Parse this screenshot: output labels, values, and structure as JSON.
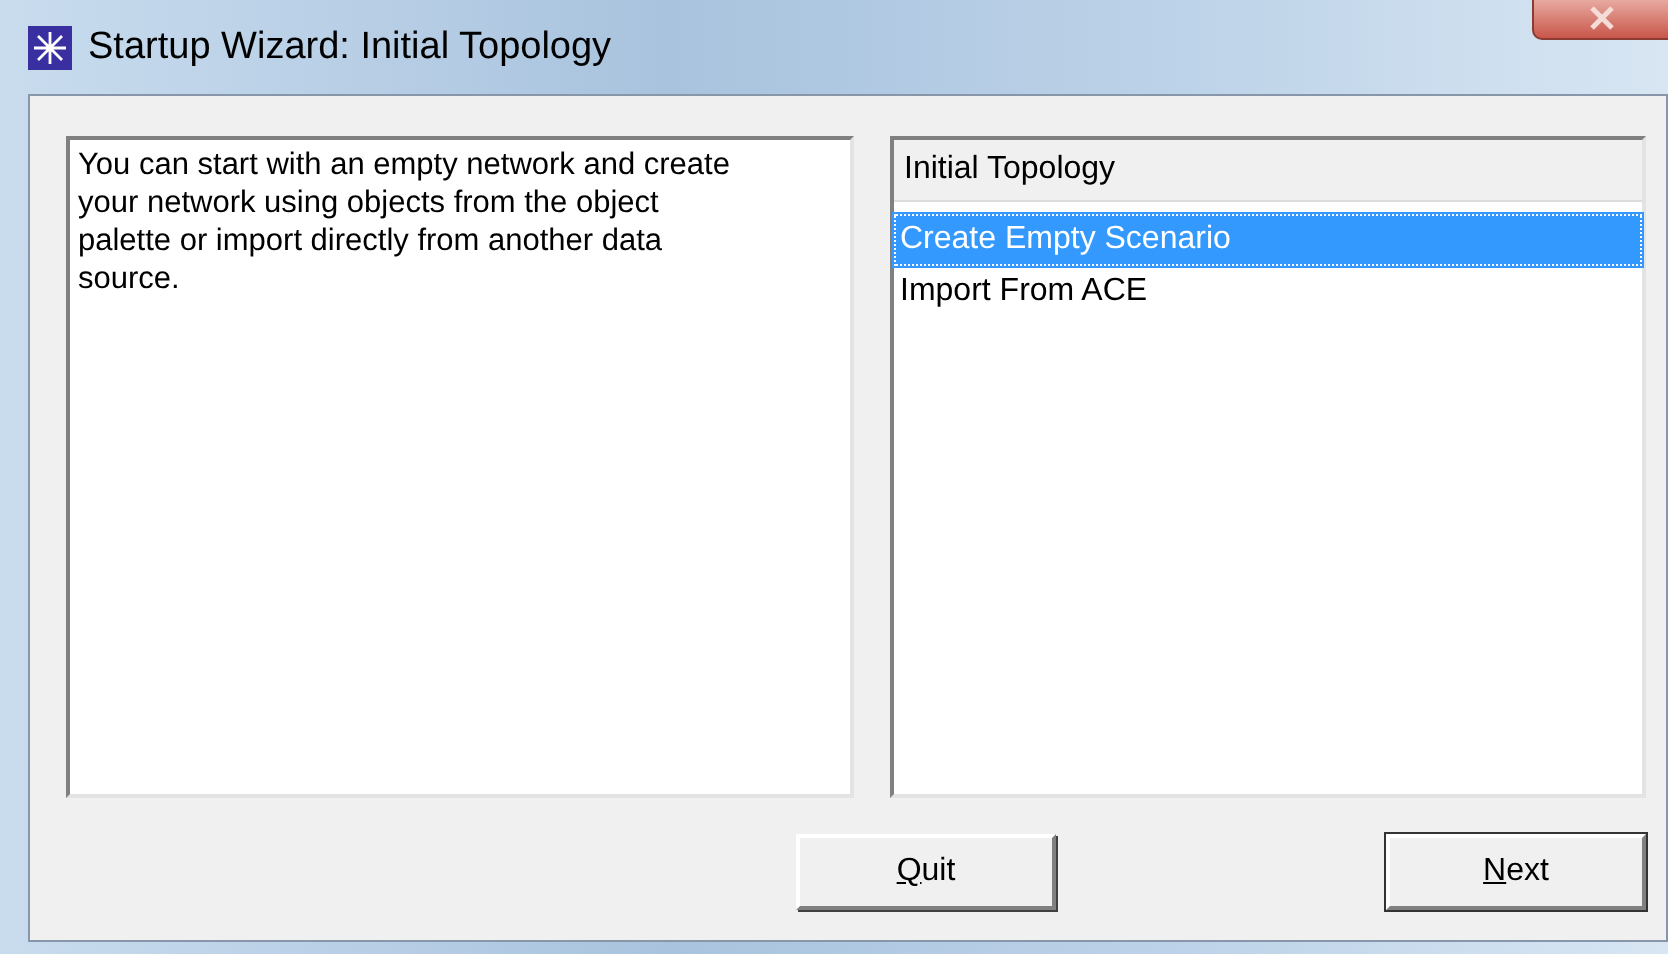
{
  "window": {
    "title": "Startup Wizard: Initial Topology"
  },
  "description": "You can start with an empty network and create your network using objects from the object palette or import directly from another data source.",
  "list": {
    "header": "Initial Topology",
    "items": [
      {
        "label": "Create Empty Scenario",
        "selected": true
      },
      {
        "label": "Import From ACE",
        "selected": false
      }
    ]
  },
  "buttons": [
    {
      "label": "Quit",
      "first_letter_underlined": true,
      "default": false
    },
    {
      "label": "Next",
      "first_letter_underlined": true,
      "default": true
    }
  ]
}
